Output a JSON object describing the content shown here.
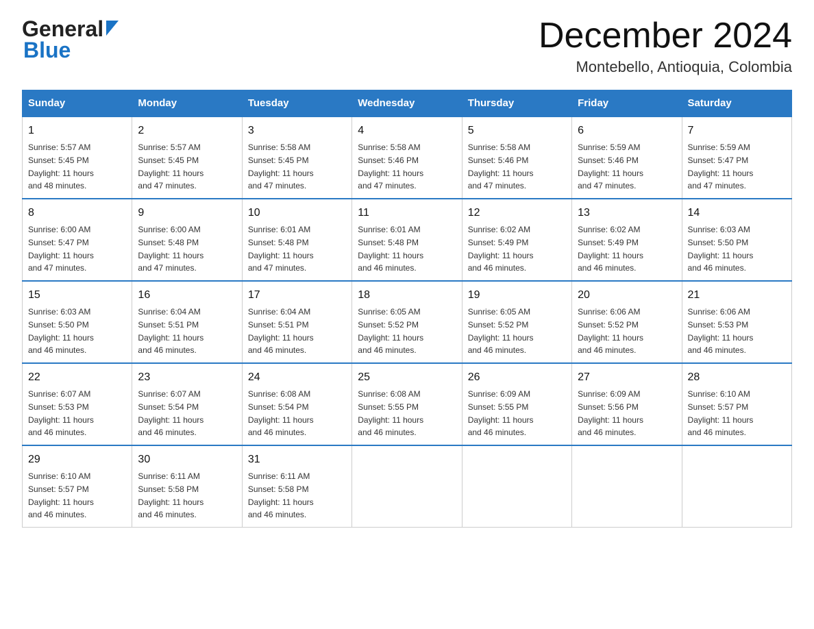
{
  "header": {
    "logo_general": "General",
    "logo_blue": "Blue",
    "title": "December 2024",
    "subtitle": "Montebello, Antioquia, Colombia"
  },
  "days_of_week": [
    "Sunday",
    "Monday",
    "Tuesday",
    "Wednesday",
    "Thursday",
    "Friday",
    "Saturday"
  ],
  "weeks": [
    [
      {
        "day": "1",
        "sunrise": "5:57 AM",
        "sunset": "5:45 PM",
        "daylight": "11 hours and 48 minutes."
      },
      {
        "day": "2",
        "sunrise": "5:57 AM",
        "sunset": "5:45 PM",
        "daylight": "11 hours and 47 minutes."
      },
      {
        "day": "3",
        "sunrise": "5:58 AM",
        "sunset": "5:45 PM",
        "daylight": "11 hours and 47 minutes."
      },
      {
        "day": "4",
        "sunrise": "5:58 AM",
        "sunset": "5:46 PM",
        "daylight": "11 hours and 47 minutes."
      },
      {
        "day": "5",
        "sunrise": "5:58 AM",
        "sunset": "5:46 PM",
        "daylight": "11 hours and 47 minutes."
      },
      {
        "day": "6",
        "sunrise": "5:59 AM",
        "sunset": "5:46 PM",
        "daylight": "11 hours and 47 minutes."
      },
      {
        "day": "7",
        "sunrise": "5:59 AM",
        "sunset": "5:47 PM",
        "daylight": "11 hours and 47 minutes."
      }
    ],
    [
      {
        "day": "8",
        "sunrise": "6:00 AM",
        "sunset": "5:47 PM",
        "daylight": "11 hours and 47 minutes."
      },
      {
        "day": "9",
        "sunrise": "6:00 AM",
        "sunset": "5:48 PM",
        "daylight": "11 hours and 47 minutes."
      },
      {
        "day": "10",
        "sunrise": "6:01 AM",
        "sunset": "5:48 PM",
        "daylight": "11 hours and 47 minutes."
      },
      {
        "day": "11",
        "sunrise": "6:01 AM",
        "sunset": "5:48 PM",
        "daylight": "11 hours and 46 minutes."
      },
      {
        "day": "12",
        "sunrise": "6:02 AM",
        "sunset": "5:49 PM",
        "daylight": "11 hours and 46 minutes."
      },
      {
        "day": "13",
        "sunrise": "6:02 AM",
        "sunset": "5:49 PM",
        "daylight": "11 hours and 46 minutes."
      },
      {
        "day": "14",
        "sunrise": "6:03 AM",
        "sunset": "5:50 PM",
        "daylight": "11 hours and 46 minutes."
      }
    ],
    [
      {
        "day": "15",
        "sunrise": "6:03 AM",
        "sunset": "5:50 PM",
        "daylight": "11 hours and 46 minutes."
      },
      {
        "day": "16",
        "sunrise": "6:04 AM",
        "sunset": "5:51 PM",
        "daylight": "11 hours and 46 minutes."
      },
      {
        "day": "17",
        "sunrise": "6:04 AM",
        "sunset": "5:51 PM",
        "daylight": "11 hours and 46 minutes."
      },
      {
        "day": "18",
        "sunrise": "6:05 AM",
        "sunset": "5:52 PM",
        "daylight": "11 hours and 46 minutes."
      },
      {
        "day": "19",
        "sunrise": "6:05 AM",
        "sunset": "5:52 PM",
        "daylight": "11 hours and 46 minutes."
      },
      {
        "day": "20",
        "sunrise": "6:06 AM",
        "sunset": "5:52 PM",
        "daylight": "11 hours and 46 minutes."
      },
      {
        "day": "21",
        "sunrise": "6:06 AM",
        "sunset": "5:53 PM",
        "daylight": "11 hours and 46 minutes."
      }
    ],
    [
      {
        "day": "22",
        "sunrise": "6:07 AM",
        "sunset": "5:53 PM",
        "daylight": "11 hours and 46 minutes."
      },
      {
        "day": "23",
        "sunrise": "6:07 AM",
        "sunset": "5:54 PM",
        "daylight": "11 hours and 46 minutes."
      },
      {
        "day": "24",
        "sunrise": "6:08 AM",
        "sunset": "5:54 PM",
        "daylight": "11 hours and 46 minutes."
      },
      {
        "day": "25",
        "sunrise": "6:08 AM",
        "sunset": "5:55 PM",
        "daylight": "11 hours and 46 minutes."
      },
      {
        "day": "26",
        "sunrise": "6:09 AM",
        "sunset": "5:55 PM",
        "daylight": "11 hours and 46 minutes."
      },
      {
        "day": "27",
        "sunrise": "6:09 AM",
        "sunset": "5:56 PM",
        "daylight": "11 hours and 46 minutes."
      },
      {
        "day": "28",
        "sunrise": "6:10 AM",
        "sunset": "5:57 PM",
        "daylight": "11 hours and 46 minutes."
      }
    ],
    [
      {
        "day": "29",
        "sunrise": "6:10 AM",
        "sunset": "5:57 PM",
        "daylight": "11 hours and 46 minutes."
      },
      {
        "day": "30",
        "sunrise": "6:11 AM",
        "sunset": "5:58 PM",
        "daylight": "11 hours and 46 minutes."
      },
      {
        "day": "31",
        "sunrise": "6:11 AM",
        "sunset": "5:58 PM",
        "daylight": "11 hours and 46 minutes."
      },
      null,
      null,
      null,
      null
    ]
  ],
  "labels": {
    "sunrise": "Sunrise:",
    "sunset": "Sunset:",
    "daylight": "Daylight:"
  }
}
